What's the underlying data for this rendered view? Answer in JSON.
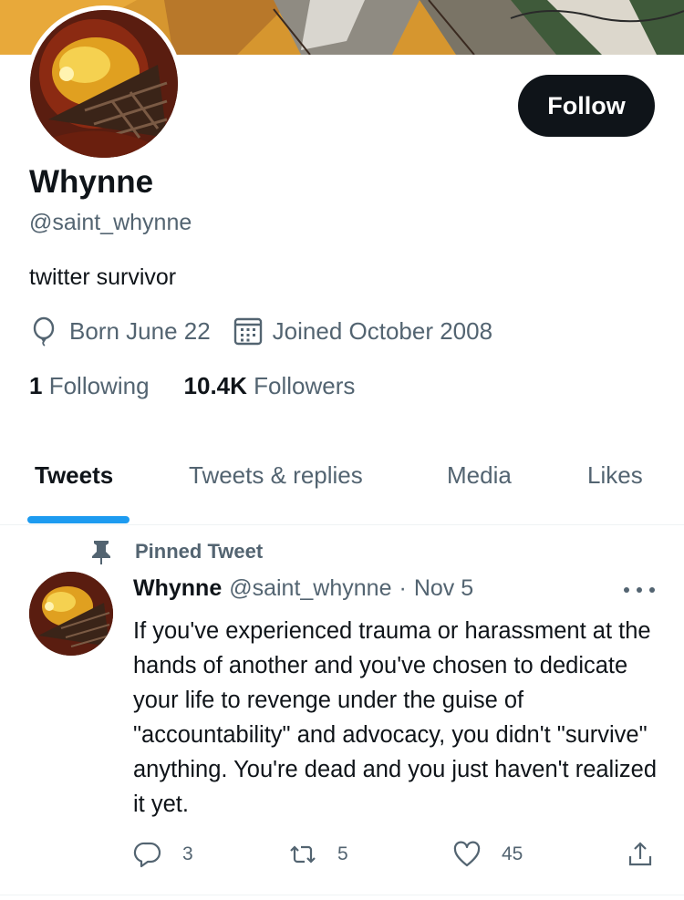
{
  "profile": {
    "display_name": "Whynne",
    "handle": "@saint_whynne",
    "bio": "twitter survivor",
    "birthday": "Born June 22",
    "joined": "Joined October 2008",
    "following_count": "1",
    "following_label": "Following",
    "followers_count": "10.4K",
    "followers_label": "Followers",
    "follow_button": "Follow"
  },
  "tabs": [
    {
      "label": "Tweets",
      "active": true
    },
    {
      "label": "Tweets & replies",
      "active": false
    },
    {
      "label": "Media",
      "active": false
    },
    {
      "label": "Likes",
      "active": false
    }
  ],
  "pinned_tweet": {
    "pinned_label": "Pinned Tweet",
    "author_name": "Whynne",
    "author_handle": "@saint_whynne",
    "separator": "·",
    "date": "Nov 5",
    "text": "If you've experienced trauma or harassment at the hands of another and you've chosen to dedicate your life to revenge under the guise of \"accountability\" and advocacy, you didn't \"survive\" anything.  You're dead and you just haven't realized it yet.",
    "replies": "3",
    "retweets": "5",
    "likes": "45"
  },
  "colors": {
    "accent": "#1d9bf0",
    "text_primary": "#0f1419",
    "text_secondary": "#536471",
    "button_dark": "#0f1419"
  },
  "icons": [
    "balloon-icon",
    "calendar-icon",
    "pin-icon",
    "more-icon",
    "reply-icon",
    "retweet-icon",
    "like-icon",
    "share-icon"
  ]
}
